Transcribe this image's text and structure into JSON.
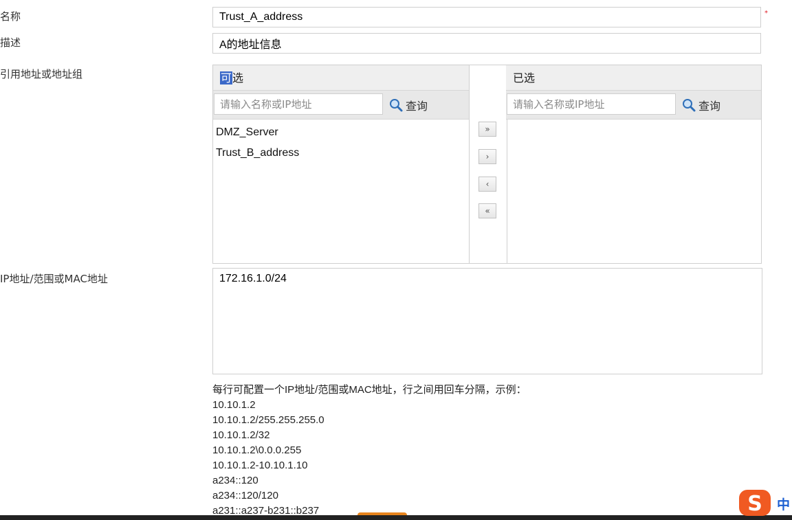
{
  "form": {
    "name": {
      "label": "名称",
      "value": "Trust_A_address",
      "required_mark": "*"
    },
    "description": {
      "label": "描述",
      "value": "A的地址信息"
    },
    "reference": {
      "label": "引用地址或地址组",
      "available": {
        "title_highlight": "可",
        "title_rest": "选",
        "search_placeholder": "请输入名称或IP地址",
        "search_label": "查询",
        "items": [
          "DMZ_Server",
          "Trust_B_address"
        ]
      },
      "selected": {
        "title": "已选",
        "search_placeholder": "请输入名称或IP地址",
        "search_label": "查询",
        "items": []
      },
      "buttons": {
        "add_all": "»",
        "add": "›",
        "remove": "‹",
        "remove_all": "«"
      }
    },
    "ip": {
      "label": "IP地址/范围或MAC地址",
      "value": "172.16.1.0/24",
      "help_title": "每行可配置一个IP地址/范围或MAC地址，行之间用回车分隔，示例：",
      "examples": [
        "10.10.1.2",
        "10.10.1.2/255.255.255.0",
        "10.10.1.2/32",
        "10.10.1.2\\0.0.0.255",
        "10.10.1.2-10.10.1.10",
        "a234::120",
        "a234::120/120",
        "a231::a237-b231::b237"
      ]
    }
  },
  "ime": {
    "char": "中",
    "logo": "S"
  },
  "colors": {
    "accent": "#3a68c8",
    "required": "#e0202a",
    "ime_orange": "#f05a22",
    "ime_blue": "#1c5fd1"
  }
}
